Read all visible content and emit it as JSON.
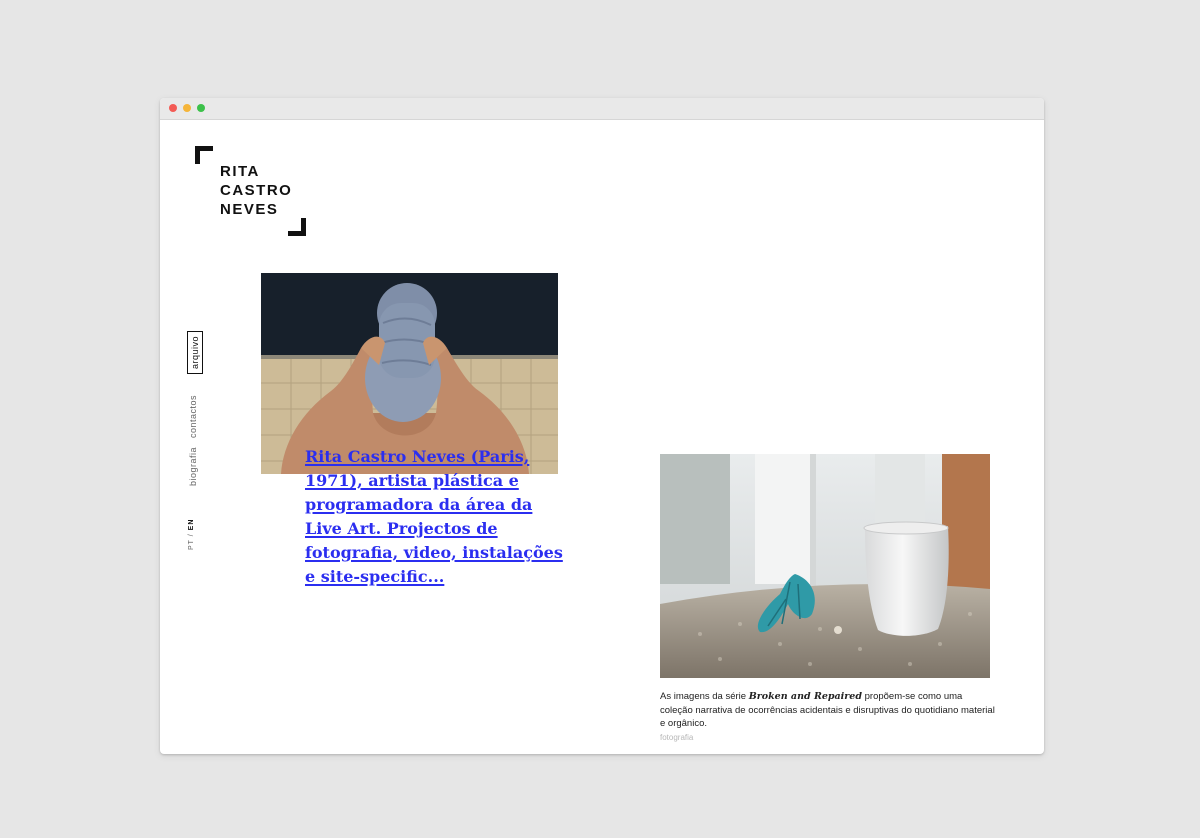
{
  "window": {
    "controls": {
      "close_color": "#f35b55",
      "minimize_color": "#f5b53a",
      "maximize_color": "#3cc14a"
    }
  },
  "logo": {
    "lines": [
      "RITA",
      "CASTRO",
      "NEVES"
    ]
  },
  "nav": {
    "archive": "arquivo",
    "contacts": "contactos",
    "bio": "biografia",
    "lang_pt": "PT",
    "lang_sep": "/",
    "lang_en": "EN"
  },
  "featured": {
    "image_icon": "photo-woman-towel",
    "bio_link": "Rita Castro Neves (Paris, 1971), artista plástica e programadora da área da Live Art. Projectos de fotografia, video, instalações e site-specific..."
  },
  "post": {
    "image_icon": "photo-cup-and-shell",
    "caption_before": "As imagens da série ",
    "caption_emph": "Broken and Repaired",
    "caption_after": " propõem-se como uma coleção narrativa de ocorrências acidentais e disruptivas do quotidiano material e orgânico.",
    "category": "fotografia"
  },
  "colors": {
    "link": "#2b2ef0",
    "text": "#111111",
    "muted": "#b8b8b8"
  }
}
